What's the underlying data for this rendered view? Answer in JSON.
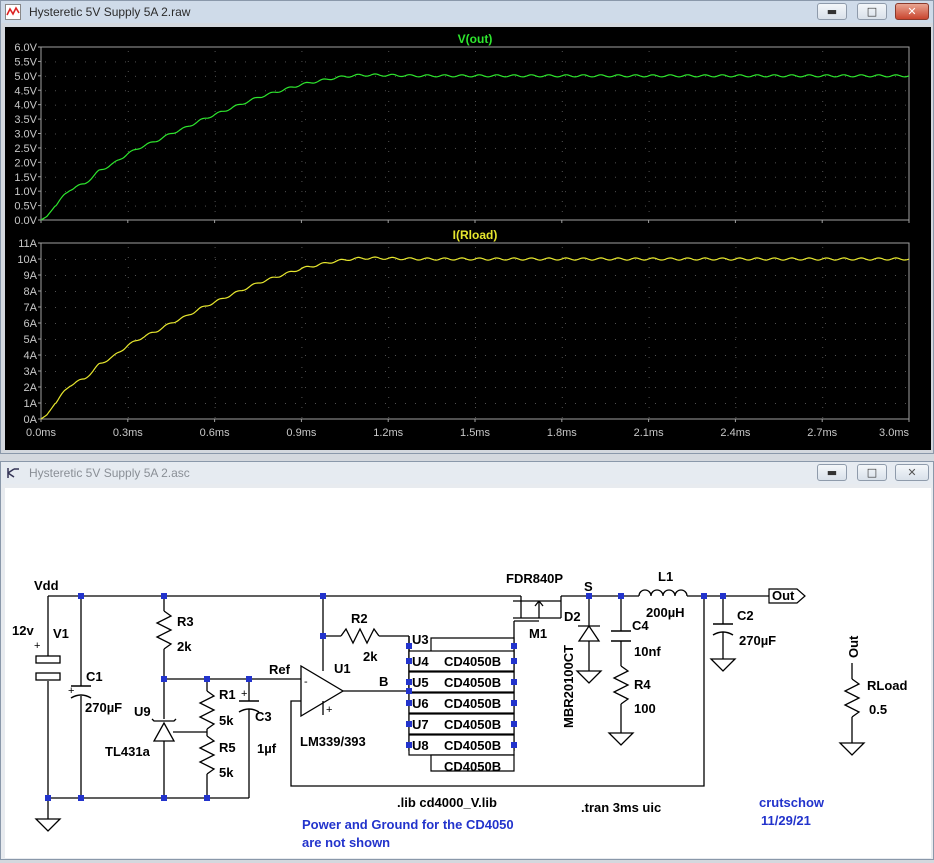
{
  "waveform_window": {
    "title": "Hysteretic 5V Supply 5A 2.raw",
    "buttons": {
      "minimize": "▬",
      "maximize": "□",
      "close": "✕"
    }
  },
  "schematic_window": {
    "title": "Hysteretic 5V Supply 5A 2.asc",
    "buttons": {
      "minimize": "▬",
      "maximize": "□",
      "close": "✕"
    }
  },
  "chart_data": [
    {
      "type": "line",
      "title": "V(out)",
      "color": "#2ee62e",
      "y_ticks": [
        "0.0V",
        "0.5V",
        "1.0V",
        "1.5V",
        "2.0V",
        "2.5V",
        "3.0V",
        "3.5V",
        "4.0V",
        "4.5V",
        "5.0V",
        "5.5V",
        "6.0V"
      ],
      "ylim": [
        0,
        6.0
      ],
      "xlim": [
        0,
        3.0
      ],
      "x": [
        0,
        0.02,
        0.05,
        0.08,
        0.1,
        0.12,
        0.15,
        0.18,
        0.2,
        0.25,
        0.3,
        0.35,
        0.4,
        0.45,
        0.5,
        0.55,
        0.6,
        0.65,
        0.7,
        0.75,
        0.8,
        0.85,
        0.9,
        0.95,
        1.0,
        1.05,
        1.1,
        1.15,
        1.2,
        1.3,
        1.5,
        2.0,
        2.5,
        3.0
      ],
      "y": [
        0,
        0.12,
        0.5,
        0.85,
        1.05,
        1.15,
        1.25,
        1.5,
        1.7,
        1.95,
        2.3,
        2.55,
        2.75,
        3.0,
        3.2,
        3.45,
        3.65,
        3.85,
        4.05,
        4.25,
        4.4,
        4.55,
        4.7,
        4.8,
        4.9,
        4.98,
        5.02,
        5.03,
        5.02,
        5.0,
        5.0,
        5.0,
        5.0,
        5.0
      ]
    },
    {
      "type": "line",
      "title": "I(Rload)",
      "color": "#e6e62e",
      "y_ticks": [
        "0A",
        "1A",
        "2A",
        "3A",
        "4A",
        "5A",
        "6A",
        "7A",
        "8A",
        "9A",
        "10A",
        "11A"
      ],
      "ylim": [
        0,
        11
      ],
      "xlim": [
        0,
        3.0
      ],
      "x_ticks": [
        "0.0ms",
        "0.3ms",
        "0.6ms",
        "0.9ms",
        "1.2ms",
        "1.5ms",
        "1.8ms",
        "2.1ms",
        "2.4ms",
        "2.7ms",
        "3.0ms"
      ],
      "x": [
        0,
        0.02,
        0.05,
        0.08,
        0.1,
        0.12,
        0.15,
        0.18,
        0.2,
        0.25,
        0.3,
        0.35,
        0.4,
        0.45,
        0.5,
        0.55,
        0.6,
        0.65,
        0.7,
        0.75,
        0.8,
        0.85,
        0.9,
        0.95,
        1.0,
        1.05,
        1.1,
        1.15,
        1.2,
        1.3,
        1.5,
        2.0,
        2.5,
        3.0
      ],
      "y": [
        0,
        0.25,
        1.0,
        1.7,
        2.1,
        2.3,
        2.5,
        3.0,
        3.4,
        3.9,
        4.6,
        5.1,
        5.5,
        6.0,
        6.4,
        6.9,
        7.3,
        7.7,
        8.1,
        8.5,
        8.8,
        9.1,
        9.4,
        9.6,
        9.8,
        9.95,
        10.04,
        10.06,
        10.04,
        10.0,
        10.0,
        10.0,
        10.0,
        10.0
      ]
    }
  ],
  "schematic": {
    "labels": {
      "vdd": "Vdd",
      "v1_val": "12v",
      "v1": "V1",
      "c1": "C1",
      "c1_val": "270µF",
      "r3": "R3",
      "r3_val": "2k",
      "r1": "R1",
      "r1_val": "5k",
      "r5": "R5",
      "r5_val": "5k",
      "c3": "C3",
      "c3_val": "1µf",
      "u9": "U9",
      "u9_part": "TL431a",
      "ref": "Ref",
      "r2": "R2",
      "r2_val": "2k",
      "u1": "U1",
      "u1_part": "LM339/393",
      "b": "B",
      "u3": "U3",
      "u4": "U4",
      "u5": "U5",
      "u6": "U6",
      "u7": "U7",
      "u8": "U8",
      "buf": "CD4050B",
      "m1_part": "FDR840P",
      "m1": "M1",
      "s": "S",
      "d2": "D2",
      "d2_part": "MBR20100CT",
      "c4": "C4",
      "c4_val": "10nf",
      "r4": "R4",
      "r4_val": "100",
      "l1": "L1",
      "l1_val": "200µH",
      "c2": "C2",
      "c2_val": "270µF",
      "out": "Out",
      "out2": "Out",
      "rload": "RLoad",
      "rload_val": "0.5",
      "lib": ".lib cd4000_V.lib",
      "tran": ".tran 3ms uic",
      "note1": "Power and Ground for the CD4050",
      "note2": "are not shown",
      "author": "crutschow",
      "date": "11/29/21"
    }
  }
}
